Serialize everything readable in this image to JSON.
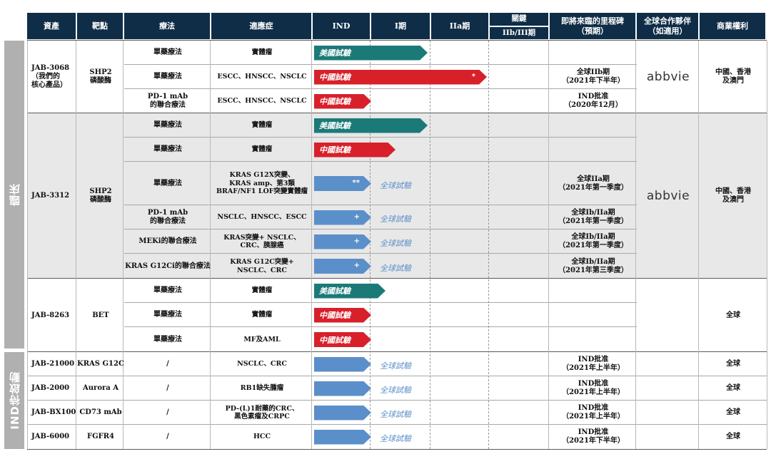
{
  "colors": {
    "header_bg": "#0f2d47",
    "us_trial": "#1b7a78",
    "china_trial": "#d8202b",
    "global_trial": "#5b8fc9",
    "side_label": "#b0b0b0"
  },
  "headers": {
    "asset": "資產",
    "target": "靶點",
    "therapy": "療法",
    "indication": "適應症",
    "ind": "IND",
    "phase1": "I期",
    "phase2a": "IIa期",
    "pivotal_top": "關鍵",
    "pivotal_bottom": "IIb/III期",
    "milestone": "即將來臨的里程碑\n（預期）",
    "partner": "全球合作夥伴\n（如適用）",
    "rights": "商業權利"
  },
  "side_labels": {
    "clinical": "臨床",
    "ind_enabling": "IND待啟動"
  },
  "assets": [
    {
      "name": "JAB-3068\n（我們的\n核心產品）",
      "target": "SHP2\n磷酸酶",
      "partner": "abbvie",
      "rights": "中國、香港\n及澳門"
    },
    {
      "name": "JAB-3312",
      "target": "SHP2\n磷酸酶",
      "partner": "abbvie",
      "rights": "中國、香港\n及澳門"
    },
    {
      "name": "JAB-8263",
      "target": "BET",
      "rights": "全球"
    }
  ],
  "rows": [
    {
      "therapy": "單藥療法",
      "indication": "實體瘤",
      "bar_label": "美國試驗",
      "bar_color": "us_trial",
      "reach": "phase1_end",
      "milestone": ""
    },
    {
      "therapy": "單藥療法",
      "indication": "ESCC、HNSCC、NSCLC",
      "bar_label": "中國試驗",
      "bar_color": "china_trial",
      "bar_mark": "*",
      "reach": "phase2a_end",
      "milestone": "全球IIb期\n（2021年下半年）"
    },
    {
      "therapy": "PD-1 mAb\n的聯合療法",
      "indication": "ESCC、HNSCC、NSCLC",
      "bar_label": "中國試驗",
      "bar_color": "china_trial",
      "reach": "ind_end",
      "milestone": "IND批准\n（2020年12月）"
    },
    {
      "therapy": "單藥療法",
      "indication": "實體瘤",
      "bar_label": "美國試驗",
      "bar_color": "us_trial",
      "reach": "phase1_end",
      "milestone": ""
    },
    {
      "therapy": "單藥療法",
      "indication": "實體瘤",
      "bar_label": "中國試驗",
      "bar_color": "china_trial",
      "reach": "phase1_mid",
      "milestone": ""
    },
    {
      "therapy": "單藥療法",
      "indication": "KRAS G12X突變、\nKRAS amp、第3類\nBRAF/NF1 LOF突變實體瘤",
      "bar_label": "",
      "bar_color": "global_trial",
      "bar_mark": "**",
      "reach": "ind_end",
      "global_label": "全球試驗",
      "milestone": "全球IIa期\n（2021年第一季度）"
    },
    {
      "therapy": "PD-1 mAb\n的聯合療法",
      "indication": "NSCLC、HNSCC、ESCC",
      "bar_label": "",
      "bar_color": "global_trial",
      "bar_mark": "+",
      "reach": "ind_end",
      "global_label": "全球試驗",
      "milestone": "全球Ib/IIa期\n（2021年第一季度）"
    },
    {
      "therapy": "MEKi的聯合療法",
      "indication": "KRAS突變+ NSCLC、\nCRC、胰腺癌",
      "bar_label": "",
      "bar_color": "global_trial",
      "bar_mark": "+",
      "reach": "ind_end",
      "global_label": "全球試驗",
      "milestone": "全球Ib/IIa期\n（2021年第一季度）"
    },
    {
      "therapy": "KRAS G12Ci的聯合療法",
      "indication": "KRAS G12C突變+\nNSCLC、CRC",
      "bar_label": "",
      "bar_color": "global_trial",
      "bar_mark": "+",
      "reach": "ind_end",
      "global_label": "全球試驗",
      "milestone": "全球Ib/IIa期\n（2021年第三季度）"
    },
    {
      "therapy": "單藥療法",
      "indication": "實體瘤",
      "bar_label": "美國試驗",
      "bar_color": "us_trial",
      "reach": "phase1_start",
      "milestone": ""
    },
    {
      "therapy": "單藥療法",
      "indication": "實體瘤",
      "bar_label": "中國試驗",
      "bar_color": "china_trial",
      "reach": "ind_end",
      "milestone": ""
    },
    {
      "therapy": "單藥療法",
      "indication": "MF及AML",
      "bar_label": "中國試驗",
      "bar_color": "china_trial",
      "reach": "ind_end",
      "milestone": ""
    },
    {
      "asset": "JAB-21000",
      "target": "KRAS G12C",
      "therapy": "/",
      "indication": "NSCLC、CRC",
      "bar_label": "",
      "bar_color": "global_trial",
      "reach": "ind_end",
      "global_label": "全球試驗",
      "milestone": "IND批准\n（2021年上半年）",
      "rights": "全球"
    },
    {
      "asset": "JAB-2000",
      "target": "Aurora A",
      "therapy": "/",
      "indication": "RB1缺失腫瘤",
      "bar_label": "",
      "bar_color": "global_trial",
      "reach": "ind_end",
      "global_label": "全球試驗",
      "milestone": "IND批准\n（2021年上半年）",
      "rights": "全球"
    },
    {
      "asset": "JAB-BX100",
      "target": "CD73 mAb",
      "therapy": "/",
      "indication": "PD-(L)1耐藥的CRC、\n黑色素瘤及CRPC",
      "bar_label": "",
      "bar_color": "global_trial",
      "reach": "ind_end",
      "global_label": "全球試驗",
      "milestone": "IND批准\n（2021年上半年）",
      "rights": "全球"
    },
    {
      "asset": "JAB-6000",
      "target": "FGFR4",
      "therapy": "/",
      "indication": "HCC",
      "bar_label": "",
      "bar_color": "global_trial",
      "reach": "ind_end",
      "global_label": "全球試驗",
      "milestone": "IND批准\n（2021年下半年）",
      "rights": "全球"
    }
  ]
}
